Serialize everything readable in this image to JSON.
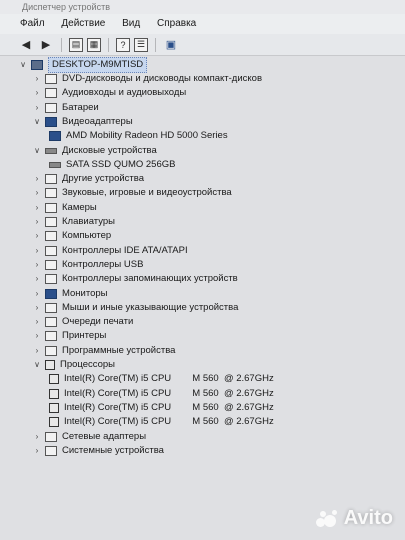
{
  "window": {
    "title": "Диспетчер устройств"
  },
  "menu": {
    "file": "Файл",
    "action": "Действие",
    "view": "Вид",
    "help": "Справка"
  },
  "tree": {
    "root": "DESKTOP-M9MTISD",
    "items": [
      {
        "label": "DVD-дисководы и дисководы компакт-дисков",
        "level": 1,
        "expanded": false
      },
      {
        "label": "Аудиовходы и аудиовыходы",
        "level": 1,
        "expanded": false
      },
      {
        "label": "Батареи",
        "level": 1,
        "expanded": false
      },
      {
        "label": "Видеоадаптеры",
        "level": 1,
        "expanded": true
      },
      {
        "label": "AMD Mobility Radeon HD 5000 Series",
        "level": 2
      },
      {
        "label": "Дисковые устройства",
        "level": 1,
        "expanded": true
      },
      {
        "label": "SATA SSD QUMO 256GB",
        "level": 2
      },
      {
        "label": "Другие устройства",
        "level": 1,
        "expanded": false
      },
      {
        "label": "Звуковые, игровые и видеоустройства",
        "level": 1,
        "expanded": false
      },
      {
        "label": "Камеры",
        "level": 1,
        "expanded": false
      },
      {
        "label": "Клавиатуры",
        "level": 1,
        "expanded": false
      },
      {
        "label": "Компьютер",
        "level": 1,
        "expanded": false
      },
      {
        "label": "Контроллеры IDE ATA/ATAPI",
        "level": 1,
        "expanded": false
      },
      {
        "label": "Контроллеры USB",
        "level": 1,
        "expanded": false
      },
      {
        "label": "Контроллеры запоминающих устройств",
        "level": 1,
        "expanded": false
      },
      {
        "label": "Мониторы",
        "level": 1,
        "expanded": false
      },
      {
        "label": "Мыши и иные указывающие устройства",
        "level": 1,
        "expanded": false
      },
      {
        "label": "Очереди печати",
        "level": 1,
        "expanded": false
      },
      {
        "label": "Принтеры",
        "level": 1,
        "expanded": false
      },
      {
        "label": "Программные устройства",
        "level": 1,
        "expanded": false
      },
      {
        "label": "Процессоры",
        "level": 1,
        "expanded": true
      },
      {
        "label": "Intel(R) Core(TM) i5 CPU        M 560  @ 2.67GHz",
        "level": 2
      },
      {
        "label": "Intel(R) Core(TM) i5 CPU        M 560  @ 2.67GHz",
        "level": 2
      },
      {
        "label": "Intel(R) Core(TM) i5 CPU        M 560  @ 2.67GHz",
        "level": 2
      },
      {
        "label": "Intel(R) Core(TM) i5 CPU        M 560  @ 2.67GHz",
        "level": 2
      },
      {
        "label": "Сетевые адаптеры",
        "level": 1,
        "expanded": false
      },
      {
        "label": "Системные устройства",
        "level": 1,
        "expanded": false
      }
    ]
  },
  "watermark": {
    "text": "Avito"
  },
  "colors": {
    "background": "#dfe0e3",
    "selection": "#c7d7ef"
  }
}
